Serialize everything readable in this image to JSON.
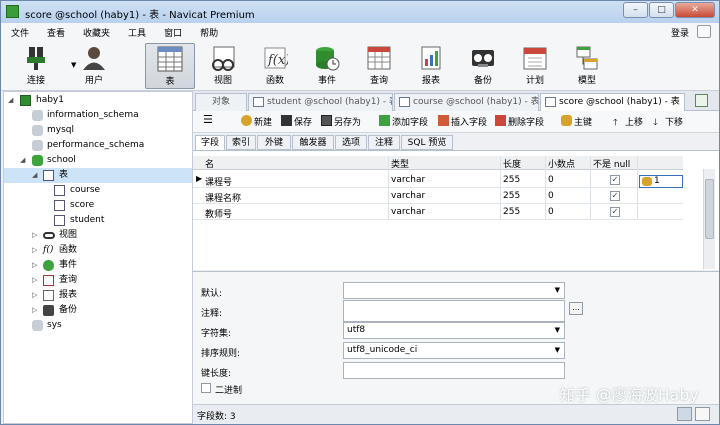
{
  "window": {
    "title": "score @school (haby1) - 表 - Navicat Premium"
  },
  "window_controls": [
    "–",
    "□",
    "✕"
  ],
  "menu": {
    "items": [
      "文件",
      "查看",
      "收藏夹",
      "工具",
      "窗口",
      "帮助"
    ],
    "login": "登录"
  },
  "toolbar": {
    "buttons": [
      {
        "label": "连接",
        "icon": "connection-icon"
      },
      {
        "label": "用户",
        "icon": "user-icon"
      },
      {
        "label": "表",
        "icon": "table-icon",
        "active": true
      },
      {
        "label": "视图",
        "icon": "view-icon"
      },
      {
        "label": "函数",
        "icon": "function-icon"
      },
      {
        "label": "事件",
        "icon": "event-icon"
      },
      {
        "label": "查询",
        "icon": "query-icon"
      },
      {
        "label": "报表",
        "icon": "report-icon"
      },
      {
        "label": "备份",
        "icon": "backup-icon"
      },
      {
        "label": "计划",
        "icon": "schedule-icon"
      },
      {
        "label": "模型",
        "icon": "model-icon"
      }
    ]
  },
  "tree": {
    "connection": "haby1",
    "databases": [
      "information_schema",
      "mysql",
      "performance_schema"
    ],
    "school": "school",
    "tables_node": "表",
    "tables": [
      "course",
      "score",
      "student"
    ],
    "folders": [
      "视图",
      "函数",
      "事件",
      "查询",
      "报表",
      "备份"
    ],
    "sys": "sys"
  },
  "tabs": {
    "object": "对象",
    "docs": [
      "student @school (haby1) - 表",
      "course @school (haby1) - 表",
      "score @school (haby1) - 表"
    ]
  },
  "object_toolbar": {
    "menu_glyph": "☰",
    "new": "新建",
    "save": "保存",
    "save_as": "另存为",
    "add_field": "添加字段",
    "insert_field": "插入字段",
    "delete_field": "删除字段",
    "primary_key": "主键",
    "move_up": "上移",
    "move_down": "下移"
  },
  "subtabs": [
    "字段",
    "索引",
    "外键",
    "触发器",
    "选项",
    "注释",
    "SQL 预览"
  ],
  "grid": {
    "headers": {
      "name": "名",
      "type": "类型",
      "length": "长度",
      "decimals": "小数点",
      "not_null": "不是 null"
    },
    "rows": [
      {
        "name": "课程号",
        "type": "varchar",
        "length": "255",
        "decimals": "0",
        "not_null": true
      },
      {
        "name": "课程名称",
        "type": "varchar",
        "length": "255",
        "decimals": "0",
        "not_null": true
      },
      {
        "name": "教师号",
        "type": "varchar",
        "length": "255",
        "decimals": "0",
        "not_null": true
      }
    ],
    "key_value": "1",
    "current_row_marker": "▶",
    "check_mark": "✓"
  },
  "properties": {
    "default_label": "默认:",
    "default_value": "",
    "comment_label": "注释:",
    "comment_value": "",
    "ellipsis": "...",
    "charset_label": "字符集:",
    "charset_value": "utf8",
    "collation_label": "排序规则:",
    "collation_value": "utf8_unicode_ci",
    "key_length_label": "键长度:",
    "key_length_value": "",
    "binary_label": "二进制"
  },
  "watermark": "知乎 @廖海波Haby",
  "status": {
    "field_count": "字段数: 3"
  }
}
